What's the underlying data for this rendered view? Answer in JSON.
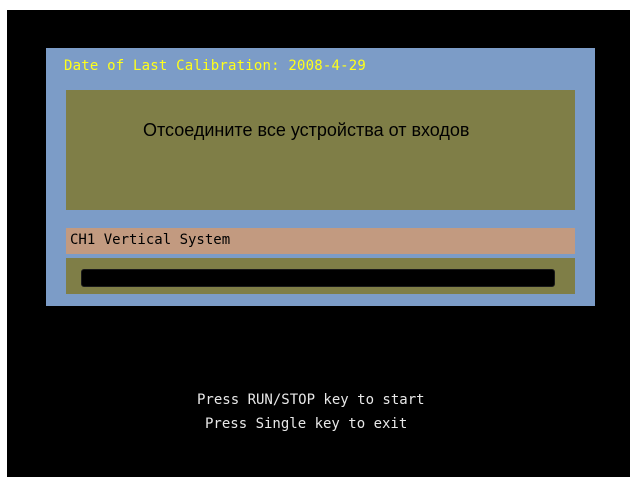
{
  "calibration": {
    "header": "Date of Last Calibration: 2008-4-29",
    "message": "Отсоедините все устройства от входов",
    "step_label": "CH1 Vertical System",
    "progress_fraction": 0.0
  },
  "instructions": {
    "line1": "Press RUN/STOP key to start",
    "line2": "Press Single key to exit"
  },
  "colors": {
    "background": "#000000",
    "panel": "#7c9cc7",
    "header_text": "#ffff1a",
    "message_box": "#7f7e47",
    "step_bar": "#c29a80",
    "instruction_text": "#e8e8e8"
  }
}
